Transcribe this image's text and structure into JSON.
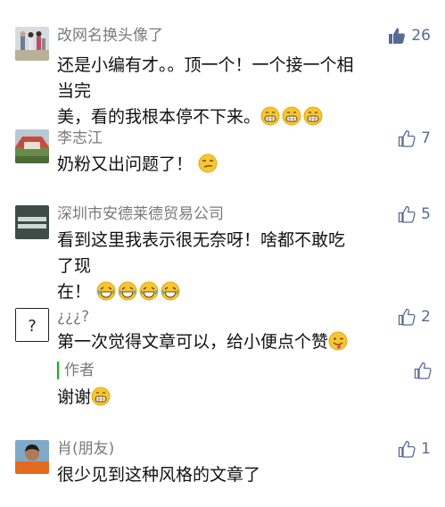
{
  "comments": [
    {
      "name": "改网名换头像了",
      "likes": "26",
      "liked": true,
      "lines": [
        "还是小编有才。。顶一个！一个接一个相当完",
        "美，看的我根本停不下来。"
      ],
      "emoji": [
        "grin-emoji",
        "grin-emoji",
        "grin-emoji"
      ]
    },
    {
      "name": "李志江",
      "likes": "7",
      "liked": false,
      "lines": [
        "奶粉又出问题了！"
      ],
      "emoji": [
        "smirk-emoji"
      ]
    },
    {
      "name": "深圳市安德莱德贸易公司",
      "likes": "5",
      "liked": false,
      "lines": [
        "看到这里我表示很无奈呀！啥都不敢吃了现",
        "在！"
      ],
      "emoji": [
        "laugh-cry-emoji",
        "laugh-cry-emoji",
        "laugh-cry-emoji",
        "laugh-cry-emoji"
      ]
    },
    {
      "name": "¿¿¿?",
      "likes": "2",
      "liked": false,
      "lines": [
        "第一次觉得文章可以，给小便点个赞"
      ],
      "emoji": [
        "wink-tongue-emoji"
      ],
      "reply": {
        "label": "作者",
        "text": "谢谢",
        "emoji": [
          "grin-emoji"
        ]
      }
    },
    {
      "name": "肖(朋友)",
      "likes": "1",
      "liked": false,
      "lines": [
        "很少见到这种风格的文章了"
      ],
      "emoji": []
    }
  ],
  "colors": {
    "like_blue": "#576b95",
    "reply_bar": "#09bb07",
    "name_gray": "#7a7a7a"
  }
}
